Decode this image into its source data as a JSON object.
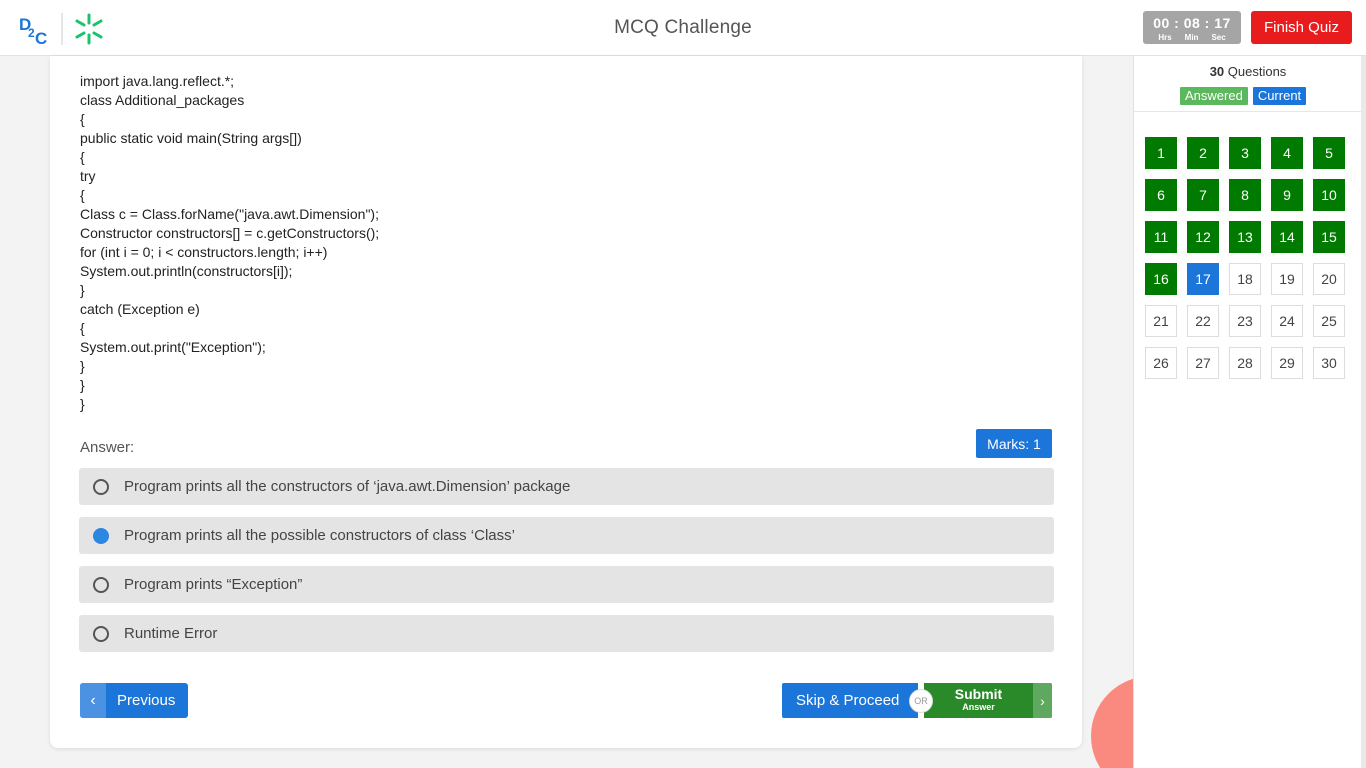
{
  "header": {
    "title": "MCQ Challenge",
    "logo_text": "D2C",
    "timer": {
      "value": "00 : 08 : 17",
      "units": [
        "Hrs",
        "Min",
        "Sec"
      ]
    },
    "finish_label": "Finish Quiz"
  },
  "question": {
    "code_lines": [
      "import java.lang.reflect.*;",
      "class Additional_packages",
      "{",
      "public static void main(String args[])",
      "{",
      "try",
      "{",
      "Class c = Class.forName(\"java.awt.Dimension\");",
      "Constructor constructors[] = c.getConstructors();",
      "for (int i = 0; i < constructors.length; i++)",
      "System.out.println(constructors[i]);",
      "}",
      "catch (Exception e)",
      "{",
      "System.out.print(\"Exception\");",
      "}",
      "}",
      "}"
    ],
    "answer_label": "Answer:",
    "marks": "Marks: 1",
    "options": [
      {
        "text": "Program prints all the constructors of ‘java.awt.Dimension’ package",
        "selected": false
      },
      {
        "text": "Program prints all the possible constructors of class ‘Class’",
        "selected": true
      },
      {
        "text": "Program prints “Exception”",
        "selected": false
      },
      {
        "text": "Runtime Error",
        "selected": false
      }
    ]
  },
  "nav": {
    "previous_label": "Previous",
    "skip_label": "Skip & Proceed",
    "or_label": "OR",
    "submit_label": "Submit",
    "submit_sub": "Answer"
  },
  "panel": {
    "count": "30",
    "count_suffix": " Questions",
    "legend_answered": "Answered",
    "legend_current": "Current",
    "questions": [
      {
        "n": "1",
        "s": "answered"
      },
      {
        "n": "2",
        "s": "answered"
      },
      {
        "n": "3",
        "s": "answered"
      },
      {
        "n": "4",
        "s": "answered"
      },
      {
        "n": "5",
        "s": "answered"
      },
      {
        "n": "6",
        "s": "answered"
      },
      {
        "n": "7",
        "s": "answered"
      },
      {
        "n": "8",
        "s": "answered"
      },
      {
        "n": "9",
        "s": "answered"
      },
      {
        "n": "10",
        "s": "answered"
      },
      {
        "n": "11",
        "s": "answered"
      },
      {
        "n": "12",
        "s": "answered"
      },
      {
        "n": "13",
        "s": "answered"
      },
      {
        "n": "14",
        "s": "answered"
      },
      {
        "n": "15",
        "s": "answered"
      },
      {
        "n": "16",
        "s": "answered"
      },
      {
        "n": "17",
        "s": "current"
      },
      {
        "n": "18",
        "s": "none"
      },
      {
        "n": "19",
        "s": "none"
      },
      {
        "n": "20",
        "s": "none"
      },
      {
        "n": "21",
        "s": "none"
      },
      {
        "n": "22",
        "s": "none"
      },
      {
        "n": "23",
        "s": "none"
      },
      {
        "n": "24",
        "s": "none"
      },
      {
        "n": "25",
        "s": "none"
      },
      {
        "n": "26",
        "s": "none"
      },
      {
        "n": "27",
        "s": "none"
      },
      {
        "n": "28",
        "s": "none"
      },
      {
        "n": "29",
        "s": "none"
      },
      {
        "n": "30",
        "s": "none"
      }
    ]
  },
  "colors": {
    "primary": "#1c75d8",
    "answered": "#007a00",
    "finish": "#e81c1c",
    "submit": "#2a8a2a",
    "logo_blue": "#1c75d8",
    "logo_green": "#19c36b"
  }
}
